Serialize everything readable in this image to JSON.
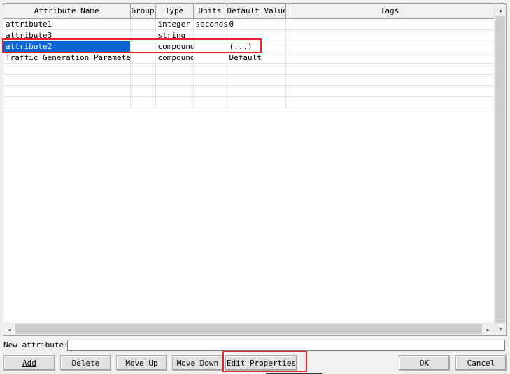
{
  "grid": {
    "columns": [
      "Attribute Name",
      "Group",
      "Type",
      "Units",
      "Default Value",
      "Tags"
    ],
    "rows": [
      {
        "name": "attribute1",
        "group": "",
        "type": "integer",
        "units": "seconds",
        "default": "0",
        "tags": ""
      },
      {
        "name": "attribute3",
        "group": "",
        "type": "string",
        "units": "",
        "default": "",
        "tags": ""
      },
      {
        "name": "attribute2",
        "group": "",
        "type": "compound",
        "units": "",
        "default": "(...)",
        "tags": ""
      },
      {
        "name": "Traffic Generation Parameters",
        "group": "",
        "type": "compound",
        "units": "",
        "default": "Default",
        "tags": ""
      },
      {
        "name": "",
        "group": "",
        "type": "",
        "units": "",
        "default": "",
        "tags": ""
      },
      {
        "name": "",
        "group": "",
        "type": "",
        "units": "",
        "default": "",
        "tags": ""
      },
      {
        "name": "",
        "group": "",
        "type": "",
        "units": "",
        "default": "",
        "tags": ""
      },
      {
        "name": "",
        "group": "",
        "type": "",
        "units": "",
        "default": "",
        "tags": ""
      }
    ],
    "selected_row": 2
  },
  "new_attribute": {
    "label": "New attribute:",
    "value": ""
  },
  "buttons": {
    "add": "Add",
    "delete": "Delete",
    "move_up": "Move Up",
    "move_down": "Move Down",
    "edit_properties": "Edit Properties",
    "ok": "OK",
    "cancel": "Cancel"
  },
  "colors": {
    "selection": "#0a64d2",
    "highlight": "#e8212d"
  }
}
